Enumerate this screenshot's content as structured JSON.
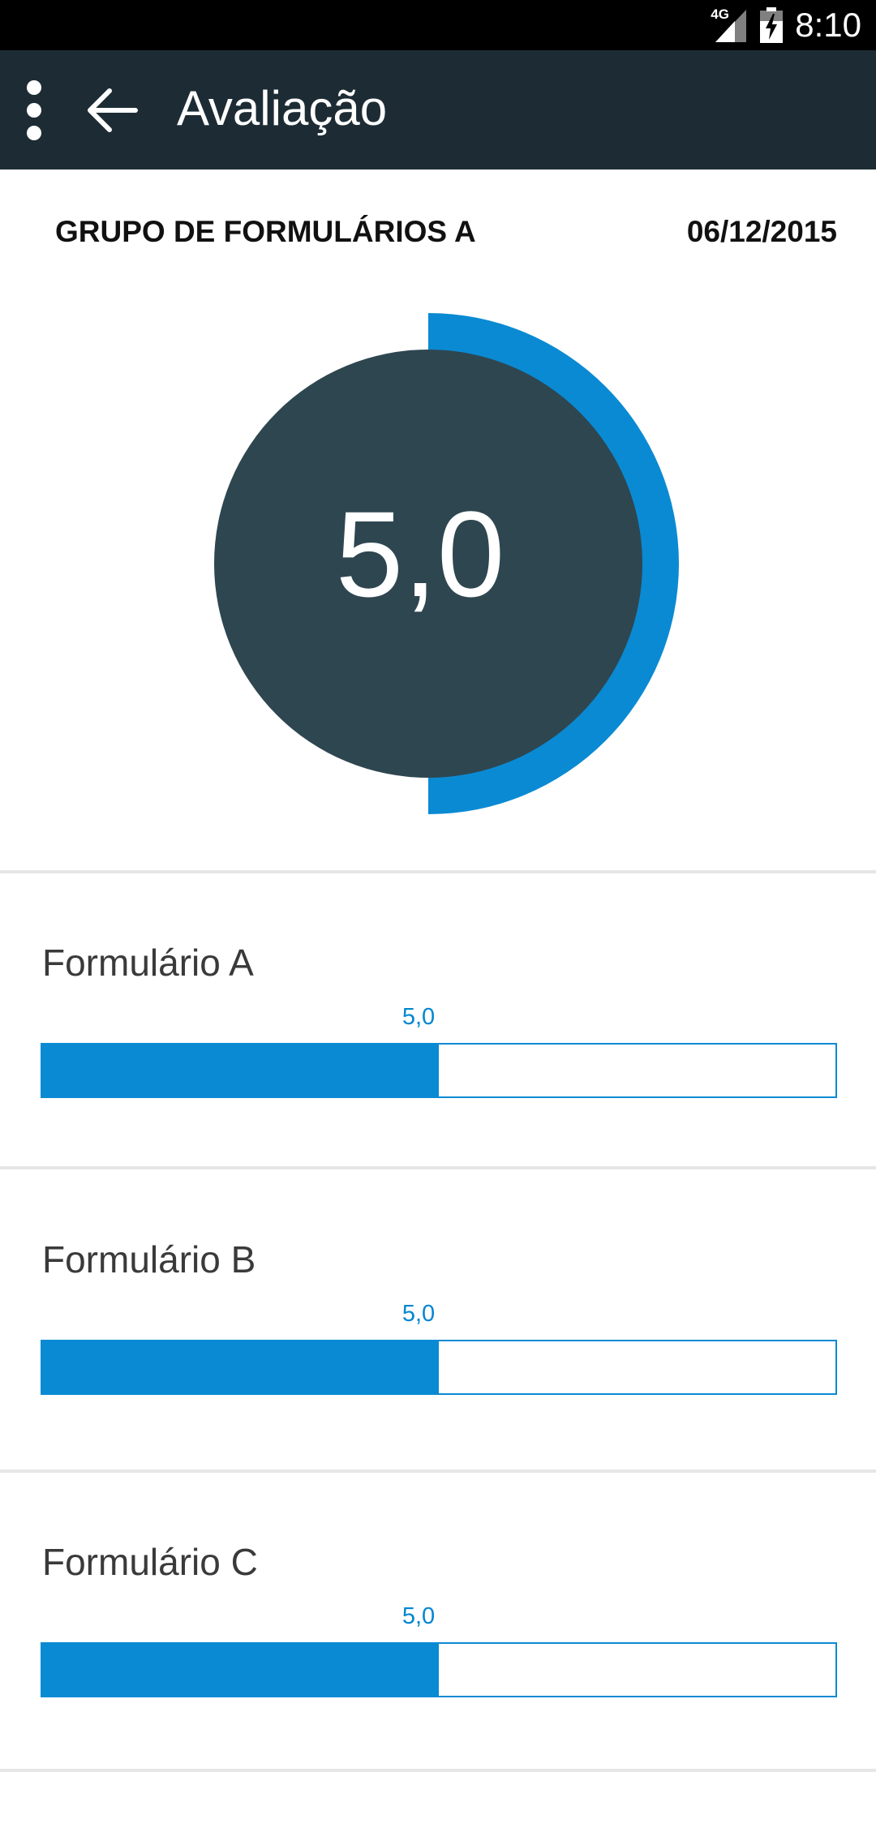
{
  "status_bar": {
    "network": "4G",
    "time": "8:10"
  },
  "app_bar": {
    "title": "Avaliação",
    "icons": [
      "overflow-menu-icon",
      "back-arrow-icon"
    ]
  },
  "summary": {
    "group_name": "GRUPO DE FORMULÁRIOS A",
    "date": "06/12/2015",
    "score": "5,0",
    "score_fraction": 0.5,
    "ring_color": "#0a8ad3",
    "circle_color": "#2e4650"
  },
  "forms": [
    {
      "name": "Formulário A",
      "value_label": "5,0",
      "fraction": 0.5
    },
    {
      "name": "Formulário B",
      "value_label": "5,0",
      "fraction": 0.5
    },
    {
      "name": "Formulário C",
      "value_label": "5,0",
      "fraction": 0.5
    }
  ],
  "colors": {
    "accent": "#0a8ad3",
    "app_bar": "#1d2c34",
    "status_bar": "#000000"
  }
}
